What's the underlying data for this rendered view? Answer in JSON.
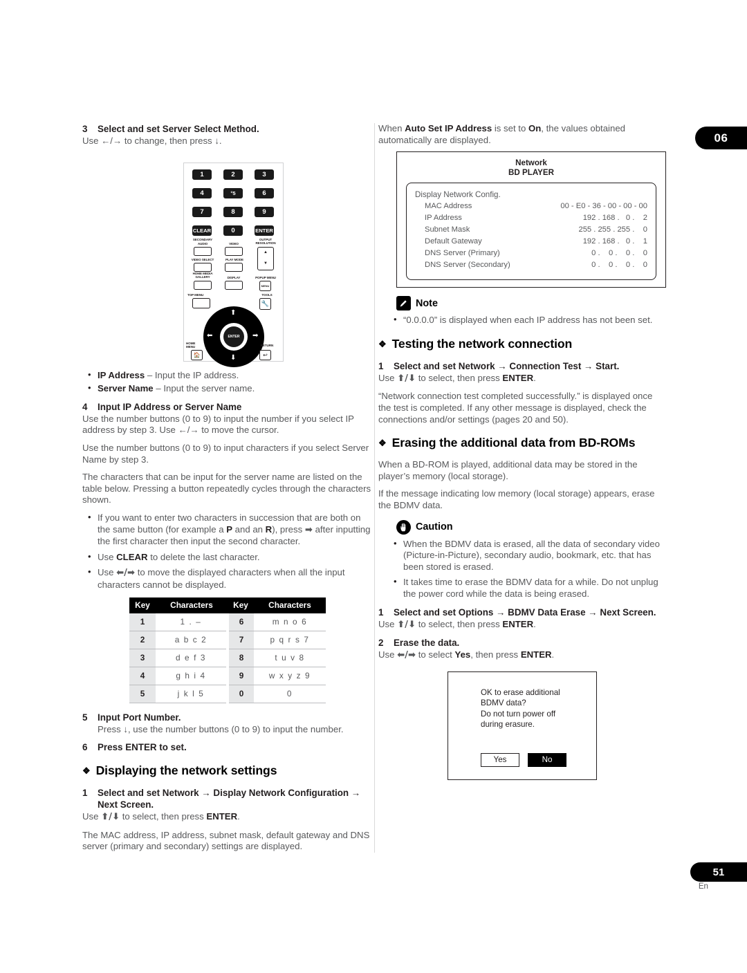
{
  "chapter_tab": "06",
  "page_number": "51",
  "page_lang": "En",
  "left": {
    "step3": {
      "num": "3",
      "title": "Select and set Server Select Method.",
      "sub": "Use ←/→ to change, then press ↓."
    },
    "remote": {
      "number_buttons": [
        "1",
        "2",
        "3",
        "4",
        "°5",
        "6",
        "7",
        "8",
        "9"
      ],
      "clear": "CLEAR",
      "zero": "0",
      "enter": "ENTER",
      "secondary": "SECONDARY",
      "audio": "AUDIO",
      "video": "VIDEO",
      "output_resolution": "OUTPUT\nRESOLUTION",
      "video_select": "VIDEO SELECT",
      "play_mode": "PLAY MODE",
      "home_media_gallery": "HOME MEDIA\nGALLERY",
      "display": "DISPLAY",
      "popup_menu": "POPUP MENU",
      "popup_menu_btn": "MENU",
      "top_menu": "TOP MENU",
      "tools": "TOOLS",
      "center_enter": "ENTER",
      "home_menu": "HOME\nMENU",
      "return": "RETURN"
    },
    "bullets_after_remote": [
      {
        "b": "IP Address",
        "t": " – Input the IP address."
      },
      {
        "b": "Server Name",
        "t": " – Input the server name."
      }
    ],
    "step4": {
      "num": "4",
      "title": "Input IP Address or Server Name",
      "p1": "Use the number buttons (0 to 9) to input the number if you select IP address by step 3. Use ←/→ to move the cursor.",
      "p2": "Use the number buttons (0 to 9) to input characters if you select Server Name by step 3.",
      "p3": "The characters that can be input for the server name are listed on the table below. Pressing a button repeatedly cycles through the characters shown."
    },
    "step4_bullets": [
      "If you want to enter two characters in succession that are both on the same button (for example a P and an R), press → after inputting the first character then input the second character.",
      "Use CLEAR to delete the last character.",
      "Use ←/→ to move the displayed characters when all the input characters cannot be displayed."
    ],
    "key_table": {
      "headers": [
        "Key",
        "Characters",
        "Key",
        "Characters"
      ],
      "rows": [
        [
          "1",
          "1 . –",
          "6",
          "m n o 6"
        ],
        [
          "2",
          "a b c 2",
          "7",
          "p q r s 7"
        ],
        [
          "3",
          "d e f 3",
          "8",
          "t u v 8"
        ],
        [
          "4",
          "g h i 4",
          "9",
          "w x y z 9"
        ],
        [
          "5",
          "j k l 5",
          "0",
          "0"
        ]
      ]
    },
    "step5": {
      "num": "5",
      "title": "Input Port Number.",
      "sub": "Press ↓, use the number buttons (0 to 9) to input the number."
    },
    "step6": {
      "num": "6",
      "title": "Press ENTER to set."
    },
    "heading_display": "Displaying the network settings",
    "display_step1": {
      "num": "1",
      "title": "Select and set Network → Display Network Configuration → Next Screen.",
      "sub": "Use ↑/↓ to select, then press ENTER."
    },
    "display_para": "The MAC address, IP address, subnet mask, default gateway and DNS server (primary and secondary) settings are displayed."
  },
  "right": {
    "intro": "When Auto Set IP Address is set to On, the values obtained automatically are displayed.",
    "screen": {
      "title1": "Network",
      "title2": "BD PLAYER",
      "label": "Display Network Config.",
      "rows": [
        {
          "name": "MAC Address",
          "value": "00 - E0 - 36 - 00 - 00 - 00"
        },
        {
          "name": "IP Address",
          "value": "192 . 168 .   0 .    2"
        },
        {
          "name": "Subnet Mask",
          "value": "255 . 255 . 255 .    0"
        },
        {
          "name": "Default Gateway",
          "value": "192 . 168 .   0 .    1"
        },
        {
          "name": "DNS Server (Primary)",
          "value": "  0 .    0 .    0 .    0"
        },
        {
          "name": "DNS Server (Secondary)",
          "value": "  0 .    0 .    0 .    0"
        }
      ]
    },
    "note": {
      "title": "Note",
      "items": [
        "“0.0.0.0” is displayed when each IP address has not been set."
      ]
    },
    "heading_testing": "Testing the network connection",
    "test_step1": {
      "num": "1",
      "title": "Select and set Network → Connection Test → Start.",
      "sub": "Use ↑/↓ to select, then press ENTER."
    },
    "test_para": "“Network connection test completed successfully.” is displayed once the test is completed. If any other message is displayed, check the connections and/or settings (pages 20 and 50).",
    "heading_erasing": "Erasing the additional data from BD-ROMs",
    "erase_p1": "When a BD-ROM is played, additional data may be stored in the player’s memory (local storage).",
    "erase_p2": "If the message indicating low memory (local storage) appears, erase the BDMV data.",
    "caution": {
      "title": "Caution",
      "items": [
        "When the BDMV data is erased, all the data of secondary video (Picture-in-Picture), secondary audio, bookmark, etc. that has been stored is erased.",
        "It takes time to erase the BDMV data for a while. Do not unplug the power cord while the data is being erased."
      ]
    },
    "erase_step1": {
      "num": "1",
      "title": "Select and set Options → BDMV Data Erase → Next Screen.",
      "sub": "Use ↑/↓ to select, then press ENTER."
    },
    "erase_step2": {
      "num": "2",
      "title": "Erase the data.",
      "sub": "Use ←/→ to select Yes, then press ENTER."
    },
    "dialog": {
      "line1": "OK to erase additional",
      "line2": "BDMV data?",
      "line3": "Do not turn power off",
      "line4": "during erasure.",
      "yes": "Yes",
      "no": "No"
    }
  }
}
